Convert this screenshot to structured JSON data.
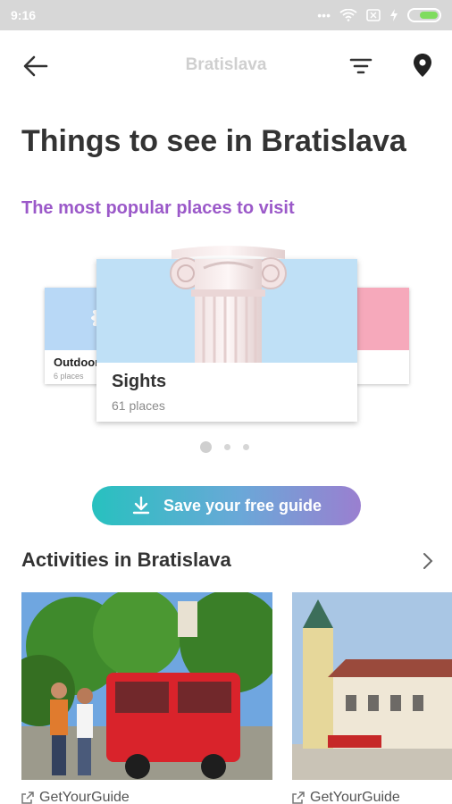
{
  "status_bar": {
    "time": "9:16",
    "icons": [
      "dots-icon",
      "wifi-icon",
      "sim-icon",
      "charging-icon",
      "battery-icon"
    ]
  },
  "toolbar": {
    "title": "Bratislava",
    "back_icon": "back-arrow-icon",
    "filter_icon": "filter-icon",
    "map_icon": "location-pin-icon"
  },
  "header": {
    "title": "Things to see in Bratislava",
    "subtitle": "The most popular places to visit"
  },
  "carousel": {
    "cards": [
      {
        "name": "Outdoors",
        "count": "6 places"
      },
      {
        "name": "Sights",
        "count": "61 places"
      },
      {
        "name": "",
        "count": ""
      }
    ],
    "active_index": 1,
    "dot_count": 3
  },
  "save_button": {
    "label": "Save your free guide",
    "icon": "download-icon"
  },
  "activities": {
    "title": "Activities in Bratislava",
    "items": [
      {
        "provider": "GetYourGuide"
      },
      {
        "provider": "GetYourGuide"
      }
    ]
  },
  "colors": {
    "accent_purple": "#9b59c9",
    "gradient_start": "#27c1bf",
    "gradient_end": "#9a7fd0"
  }
}
